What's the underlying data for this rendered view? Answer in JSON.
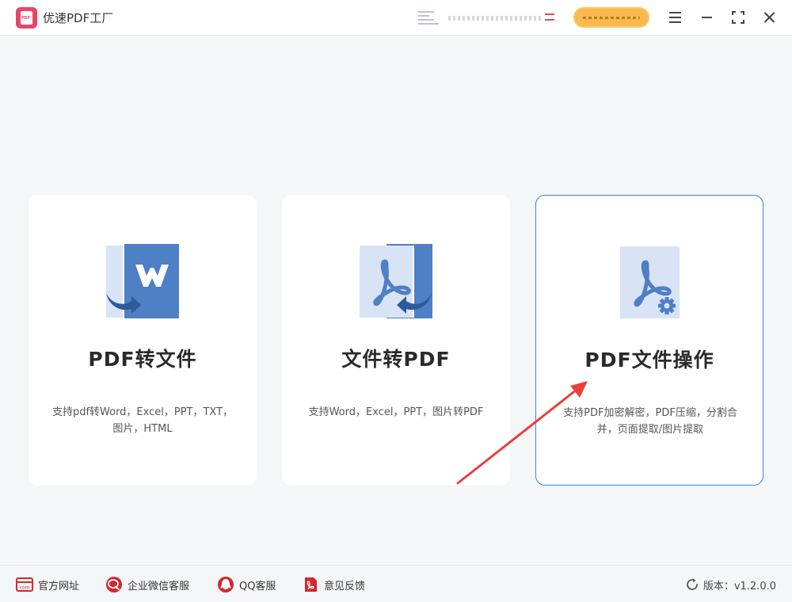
{
  "app": {
    "title": "优速PDF工厂",
    "logo_text": "PDF"
  },
  "colors": {
    "accent": "#2f86df",
    "brand": "#e8456b",
    "vip": "#fbb84c",
    "icon_blue": "#4f7fc4",
    "icon_light": "#d8e4f6",
    "annotation": "#e8403b",
    "footer_icon": "#d6262e"
  },
  "cards": [
    {
      "title": "PDF转文件",
      "desc_lines": [
        "支持pdf转Word，Excel，PPT，TXT，",
        "图片，HTML"
      ],
      "icon": "pdf-to-word-icon"
    },
    {
      "title": "文件转PDF",
      "desc_lines": [
        "支持Word，Excel，PPT，图片转PDF"
      ],
      "icon": "file-to-pdf-icon"
    },
    {
      "title": "PDF文件操作",
      "desc_lines": [
        "支持PDF加密解密，PDF压缩，分割合",
        "并，页面提取/图片提取"
      ],
      "icon": "pdf-settings-icon",
      "selected": true
    }
  ],
  "footer": {
    "links": [
      {
        "label": "官方网址",
        "icon": "website-icon"
      },
      {
        "label": "企业微信客服",
        "icon": "wechat-work-icon"
      },
      {
        "label": "QQ客服",
        "icon": "qq-icon"
      },
      {
        "label": "意见反馈",
        "icon": "feedback-icon"
      }
    ],
    "version": "版本：v1.2.0.0"
  }
}
